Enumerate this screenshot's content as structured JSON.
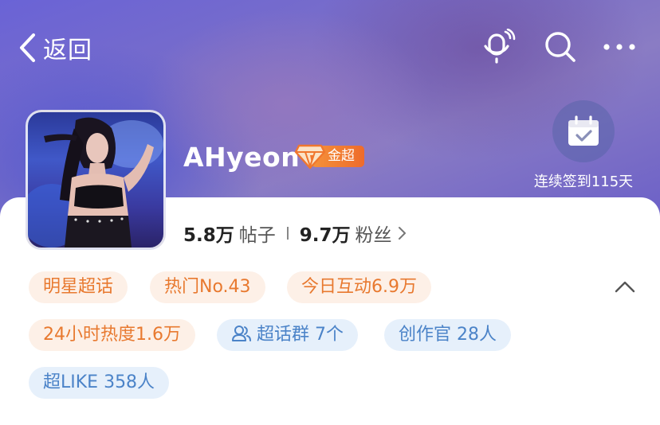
{
  "header": {
    "back_label": "返回"
  },
  "icons": [
    "chevron-left-icon",
    "microphone-icon",
    "search-icon",
    "more-icon",
    "calendar-check-icon",
    "diamond-icon",
    "chevron-right-icon",
    "group-icon",
    "chevron-up-icon"
  ],
  "profile": {
    "name": "AHyeon",
    "badge_label": "金超",
    "checkin_label": "连续签到115天",
    "posts_count": "5.8万",
    "posts_unit": "帖子",
    "fans_count": "9.7万",
    "fans_unit": "粉丝"
  },
  "tags": {
    "row1": [
      "明星超话",
      "热门No.43",
      "今日互动6.9万"
    ],
    "heat": "24小时热度1.6万",
    "group": "超话群 7个",
    "creator": "创作官 28人",
    "like": "超LIKE 358人"
  },
  "colors": {
    "orange_tag_text": "#e8792f",
    "orange_tag_bg": "#fdf0e7",
    "blue_tag_text": "#4b83c8",
    "blue_tag_bg": "#e6f0fb",
    "badge": "#f0772e"
  }
}
